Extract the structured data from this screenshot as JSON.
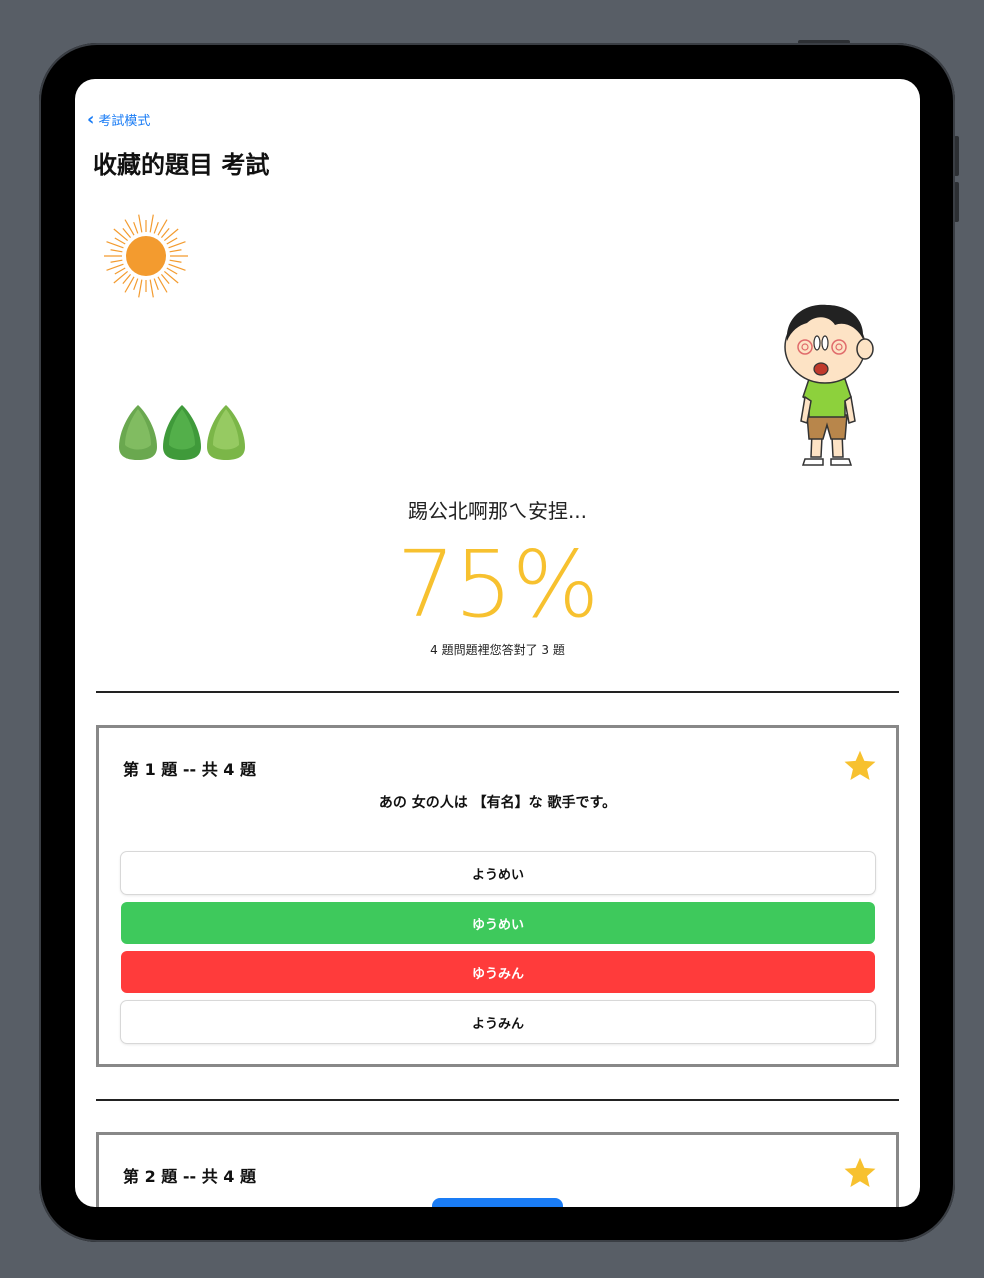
{
  "nav": {
    "back_label": "考試模式",
    "title": "收藏的題目 考試"
  },
  "result": {
    "message": "踢公北啊那ㄟ安捏...",
    "percentage": "75%",
    "summary": "4 題問題裡您答對了 3 題"
  },
  "questions": [
    {
      "header": "第 1 題 -- 共 4 題",
      "text": "あの 女の人は 【有名】な 歌手です。",
      "options": [
        {
          "label": "ようめい",
          "state": "plain"
        },
        {
          "label": "ゆうめい",
          "state": "correct"
        },
        {
          "label": "ゆうみん",
          "state": "wrong"
        },
        {
          "label": "ようみん",
          "state": "plain"
        }
      ]
    },
    {
      "header": "第 2 題 -- 共 4 題"
    }
  ],
  "colors": {
    "accent": "#1a7cf5",
    "percentage": "#f7c12f",
    "correct": "#3ec95c",
    "wrong": "#ff3b3b",
    "star": "#f7c12f"
  },
  "icons": [
    "chevron-left-icon",
    "sun-icon",
    "tree-icon",
    "boy-illustration",
    "star-icon"
  ]
}
